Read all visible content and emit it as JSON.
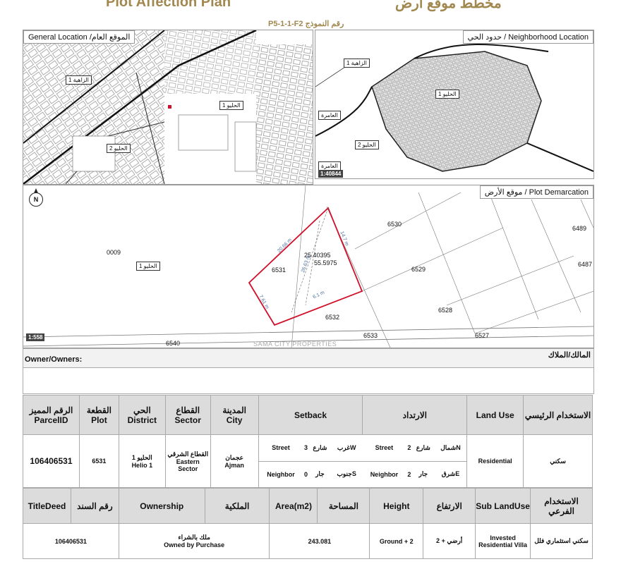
{
  "header": {
    "title_en": "Plot Affection Plan",
    "title_ar": "مخطط موقع ارض",
    "form_number": "P5-1-1-F2 رقم النموذج"
  },
  "maps": {
    "general": {
      "label": "General Location /الموقع العام",
      "tags": [
        "الزاهية 1",
        "الحليو 1",
        "الحليو 2"
      ]
    },
    "neighborhood": {
      "label": "حدود الحي / Neighborhood Location",
      "tags": [
        "الزاهية 1",
        "الحليو 1",
        "العامرة",
        "الحليو 2",
        "العامرة"
      ],
      "scale": "1:40844"
    },
    "plot": {
      "label": "موقع الأرض / Plot Demarcation",
      "scale": "1:558",
      "tag": "الحليو 1",
      "coords": [
        "25.40395",
        "55.5975"
      ],
      "plots": [
        "6530",
        "6489",
        "0009",
        "6531",
        "6529",
        "6487",
        "6528",
        "6532",
        "6533",
        "6527",
        "6540"
      ],
      "dims": [
        "20.66 m",
        "14.7 m",
        "26.63 m",
        "7.61 m",
        "6.1 m"
      ],
      "watermark": "SAMA CITY PROPERTIES"
    }
  },
  "owners": {
    "label_en": "Owner/Owners:",
    "label_ar": "المالك/الملاك"
  },
  "table1": {
    "headers": {
      "parcel_ar": "الرقم المميز",
      "parcel_en": "ParcelID",
      "plot_ar": "القطعة",
      "plot_en": "Plot",
      "district_ar": "الحي",
      "district_en": "District",
      "sector_ar": "القطاع",
      "sector_en": "Sector",
      "city_ar": "المدينة",
      "city_en": "City",
      "setback_en": "Setback",
      "setback_ar": "الارتداد",
      "landuse_en": "Land Use",
      "landuse_ar": "الاستخدام الرئيسي"
    },
    "values": {
      "parcel": "106406531",
      "plot": "6531",
      "district_ar": "الحليو 1",
      "district_en": "Helio 1",
      "sector_ar": "القطاع الشرقي",
      "sector_en": "Eastern Sector",
      "city_ar": "عجمان",
      "city_en": "Ajman",
      "landuse_en": "Residential",
      "landuse_ar": "سكني"
    },
    "setback": {
      "row1": [
        "Street",
        "3",
        "شارع",
        "غربW",
        "Street",
        "2",
        "شارع",
        "شمالN"
      ],
      "row2": [
        "Neighbor",
        "0",
        "جار",
        "جنوبS",
        "Neighbor",
        "2",
        "جار",
        "شرقE"
      ]
    }
  },
  "table2": {
    "headers": {
      "titledeed_en": "TitleDeed",
      "titledeed_ar": "رقم السند",
      "ownership_en": "Ownership",
      "ownership_ar": "الملكية",
      "area_en": "Area(m2)",
      "area_ar": "المساحة",
      "height_en": "Height",
      "height_ar": "الارتفاع",
      "sublanduse_en": "Sub LandUse",
      "sublanduse_ar": "الاستخدام الفرعي"
    },
    "values": {
      "titledeed": "106406531",
      "ownership_ar": "ملك بالشراء",
      "ownership_en": "Owned by Purchase",
      "area": "243.081",
      "height_en": "Ground + 2",
      "height_ar": "أرضي + 2",
      "sublanduse_en": "Invested Residential Villa",
      "sublanduse_ar": "سكني استثماري فلل"
    }
  },
  "colors": {
    "gold": "#a0884f",
    "plot_outline": "#d0102a",
    "header_gray": "#dcdcdc"
  }
}
